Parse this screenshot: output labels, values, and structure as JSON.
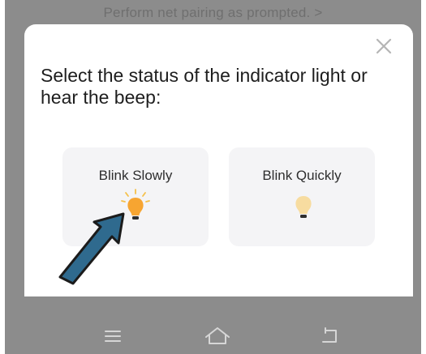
{
  "top_hint": "Perform net pairing as prompted. >",
  "dialog": {
    "title": "Select the status of the indicator light or hear the beep:",
    "options": [
      {
        "label": "Blink Slowly",
        "icon": "lit-bulb-icon"
      },
      {
        "label": "Blink Quickly",
        "icon": "dim-bulb-icon"
      }
    ],
    "close_icon": "close-icon"
  },
  "nav_icons": [
    "menu-icon",
    "home-icon",
    "back-icon"
  ],
  "colors": {
    "backdrop": "#8c8c8c",
    "card": "#f4f4f6",
    "bulb_lit": "#f7a531",
    "bulb_dim": "#f7dca0",
    "arrow": "#2f6a8e"
  }
}
